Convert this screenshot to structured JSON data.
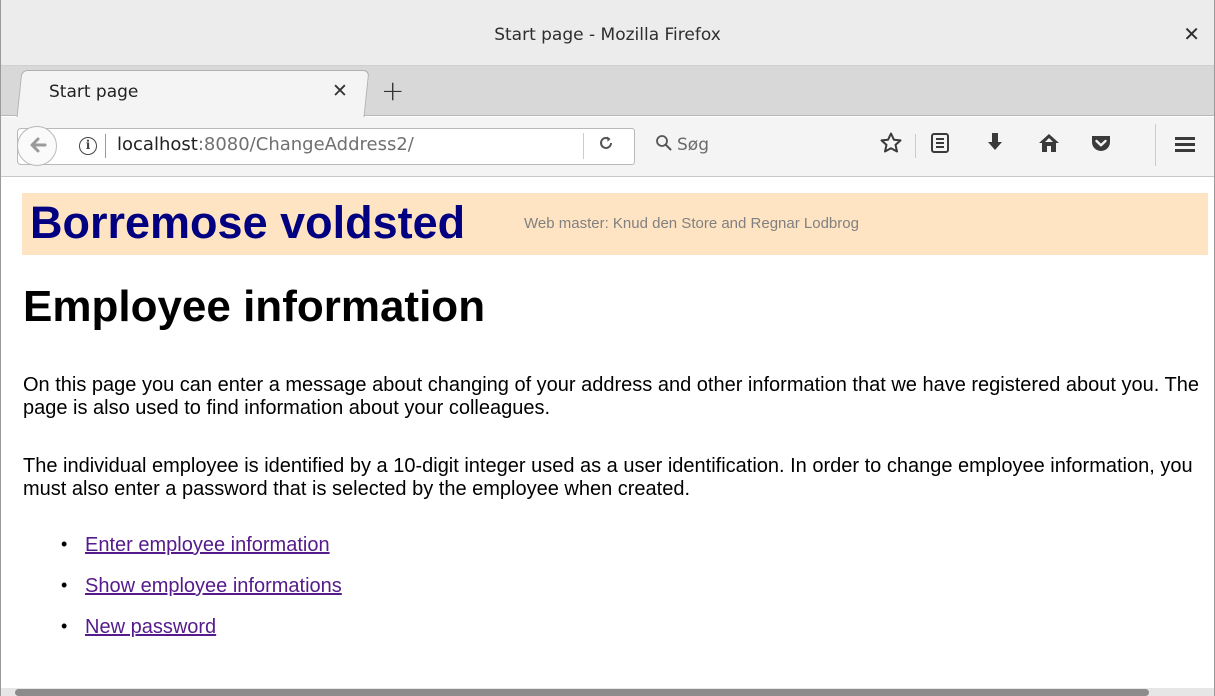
{
  "window": {
    "title": "Start page - Mozilla Firefox",
    "close_glyph": "✕"
  },
  "tabs": [
    {
      "label": "Start page",
      "close_glyph": "✕"
    }
  ],
  "newtab_glyph": "+",
  "navbar": {
    "back_glyph": "🡐",
    "info_glyph": "i",
    "url_host": "localhost",
    "url_rest": ":8080/ChangeAddress2/",
    "reload_glyph": "↻",
    "search_glyph": "🔍",
    "search_placeholder": "Søg",
    "icons": [
      "bookmark-star-icon",
      "reading-list-icon",
      "download-icon",
      "home-icon",
      "pocket-icon",
      "menu-icon"
    ]
  },
  "page": {
    "banner_title": "Borremose voldsted",
    "banner_subtitle": "Web master: Knud den Store and Regnar Lodbrog",
    "banner_bg": "#ffe4c4",
    "banner_title_color": "#000080",
    "heading": "Employee information",
    "paragraph1": "On this page you can enter a message about changing of your address and other information that we have registered about you. The page is also used to find information about your colleagues.",
    "paragraph2": "The individual employee is identified by a 10-digit integer used as a user identification. In order to change employee information, you must also enter a password that is selected by the employee when created.",
    "links": [
      {
        "label": "Enter employee information"
      },
      {
        "label": "Show employee informations"
      },
      {
        "label": "New password"
      }
    ],
    "link_color": "#551a8b"
  }
}
